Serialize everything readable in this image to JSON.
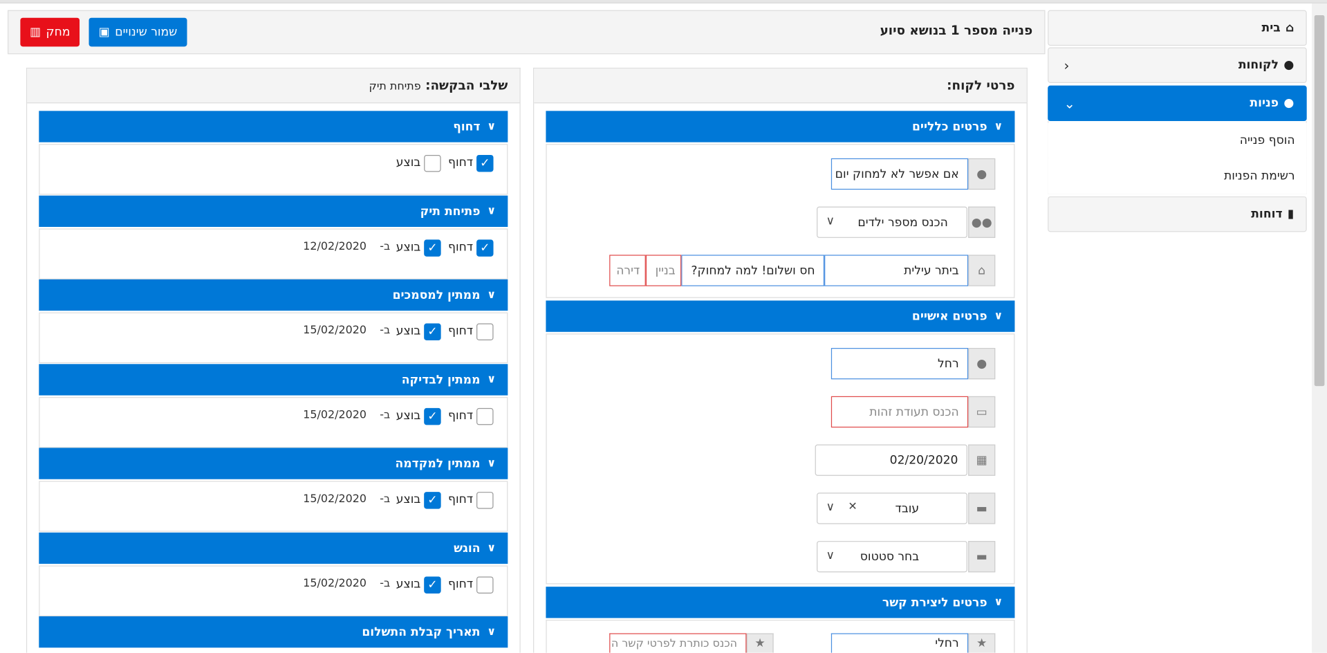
{
  "sidebar": {
    "home": "בית",
    "customers": "לקוחות",
    "inquiries": "פניות",
    "add_inquiry": "הוסף פנייה",
    "inquiry_list": "רשימת הפניות",
    "reports": "דוחות"
  },
  "header": {
    "title": "פנייה מספר 1 בנושא סיוע",
    "save_label": "שמור שינויים",
    "delete_label": "מחק"
  },
  "customer": {
    "title": "פרטי לקוח:",
    "general_section": "פרטים כלליים",
    "name_value": "אם אפשר לא למחוק יום נעים ה",
    "children_placeholder": "הכנס מספר ילדים",
    "city_value": "ביתר עילית",
    "street_value": "חס ושלום! למה למחוק?",
    "building_placeholder": "בניין",
    "apartment_placeholder": "דירה",
    "personal_section": "פרטים אישיים",
    "first_name_value": "רחל",
    "id_placeholder": "הכנס תעודת זהות",
    "date_value": "02/20/2020",
    "occupation_value": "עובד",
    "status_placeholder": "בחר סטטוס",
    "contact_section": "פרטים ליצירת קשר",
    "contact_name_value": "רחלי",
    "contact_address_placeholder": "הכנס כותרת לפרטי קשר הנל"
  },
  "steps": {
    "title": "שלבי הבקשה:",
    "current": "פתיחת תיק",
    "urgent_label": "דחוף",
    "done_label": "בוצע",
    "on_label": "ב-",
    "items": [
      {
        "name": "דחוף",
        "urgent": true,
        "done": false,
        "date": ""
      },
      {
        "name": "פתיחת תיק",
        "urgent": true,
        "done": true,
        "date": "12/02/2020"
      },
      {
        "name": "ממתין למסמכים",
        "urgent": false,
        "done": true,
        "date": "15/02/2020"
      },
      {
        "name": "ממתין לבדיקה",
        "urgent": false,
        "done": true,
        "date": "15/02/2020"
      },
      {
        "name": "ממתין למקדמה",
        "urgent": false,
        "done": true,
        "date": "15/02/2020"
      },
      {
        "name": "הוגש",
        "urgent": false,
        "done": true,
        "date": "15/02/2020"
      },
      {
        "name": "תאריך קבלת התשלום",
        "urgent": false,
        "done": false,
        "date": ""
      }
    ]
  },
  "colors": {
    "primary": "#0078d7",
    "danger": "#e8101a"
  }
}
